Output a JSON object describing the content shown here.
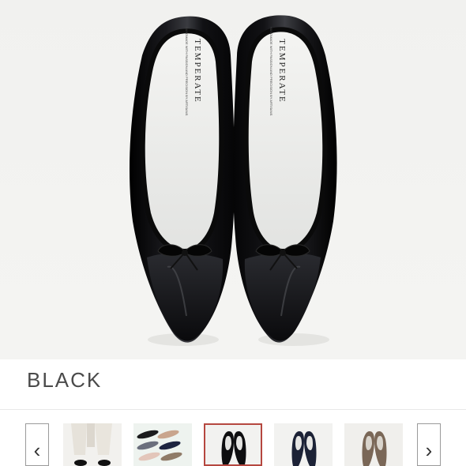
{
  "product": {
    "color_name": "BLACK",
    "insole_brand": "TEMPERATE",
    "insole_subtext": "HANDMADE WITH PASSION AND PRECISION BY ARTISANS"
  },
  "gallery": {
    "prev_icon": "chevron-left-icon",
    "next_icon": "chevron-right-icon",
    "prev_glyph": "‹",
    "next_glyph": "›",
    "thumbnails": [
      {
        "name": "thumb-model-legs",
        "selected": false
      },
      {
        "name": "thumb-color-lineup",
        "selected": false
      },
      {
        "name": "thumb-black-pair",
        "selected": true
      },
      {
        "name": "thumb-navy-pair",
        "selected": false
      },
      {
        "name": "thumb-beige-pair",
        "selected": false
      }
    ]
  },
  "colors": {
    "selected_border": "#b5473f",
    "patent_black": "#0d0d0f",
    "background": "#f2f2f0"
  }
}
